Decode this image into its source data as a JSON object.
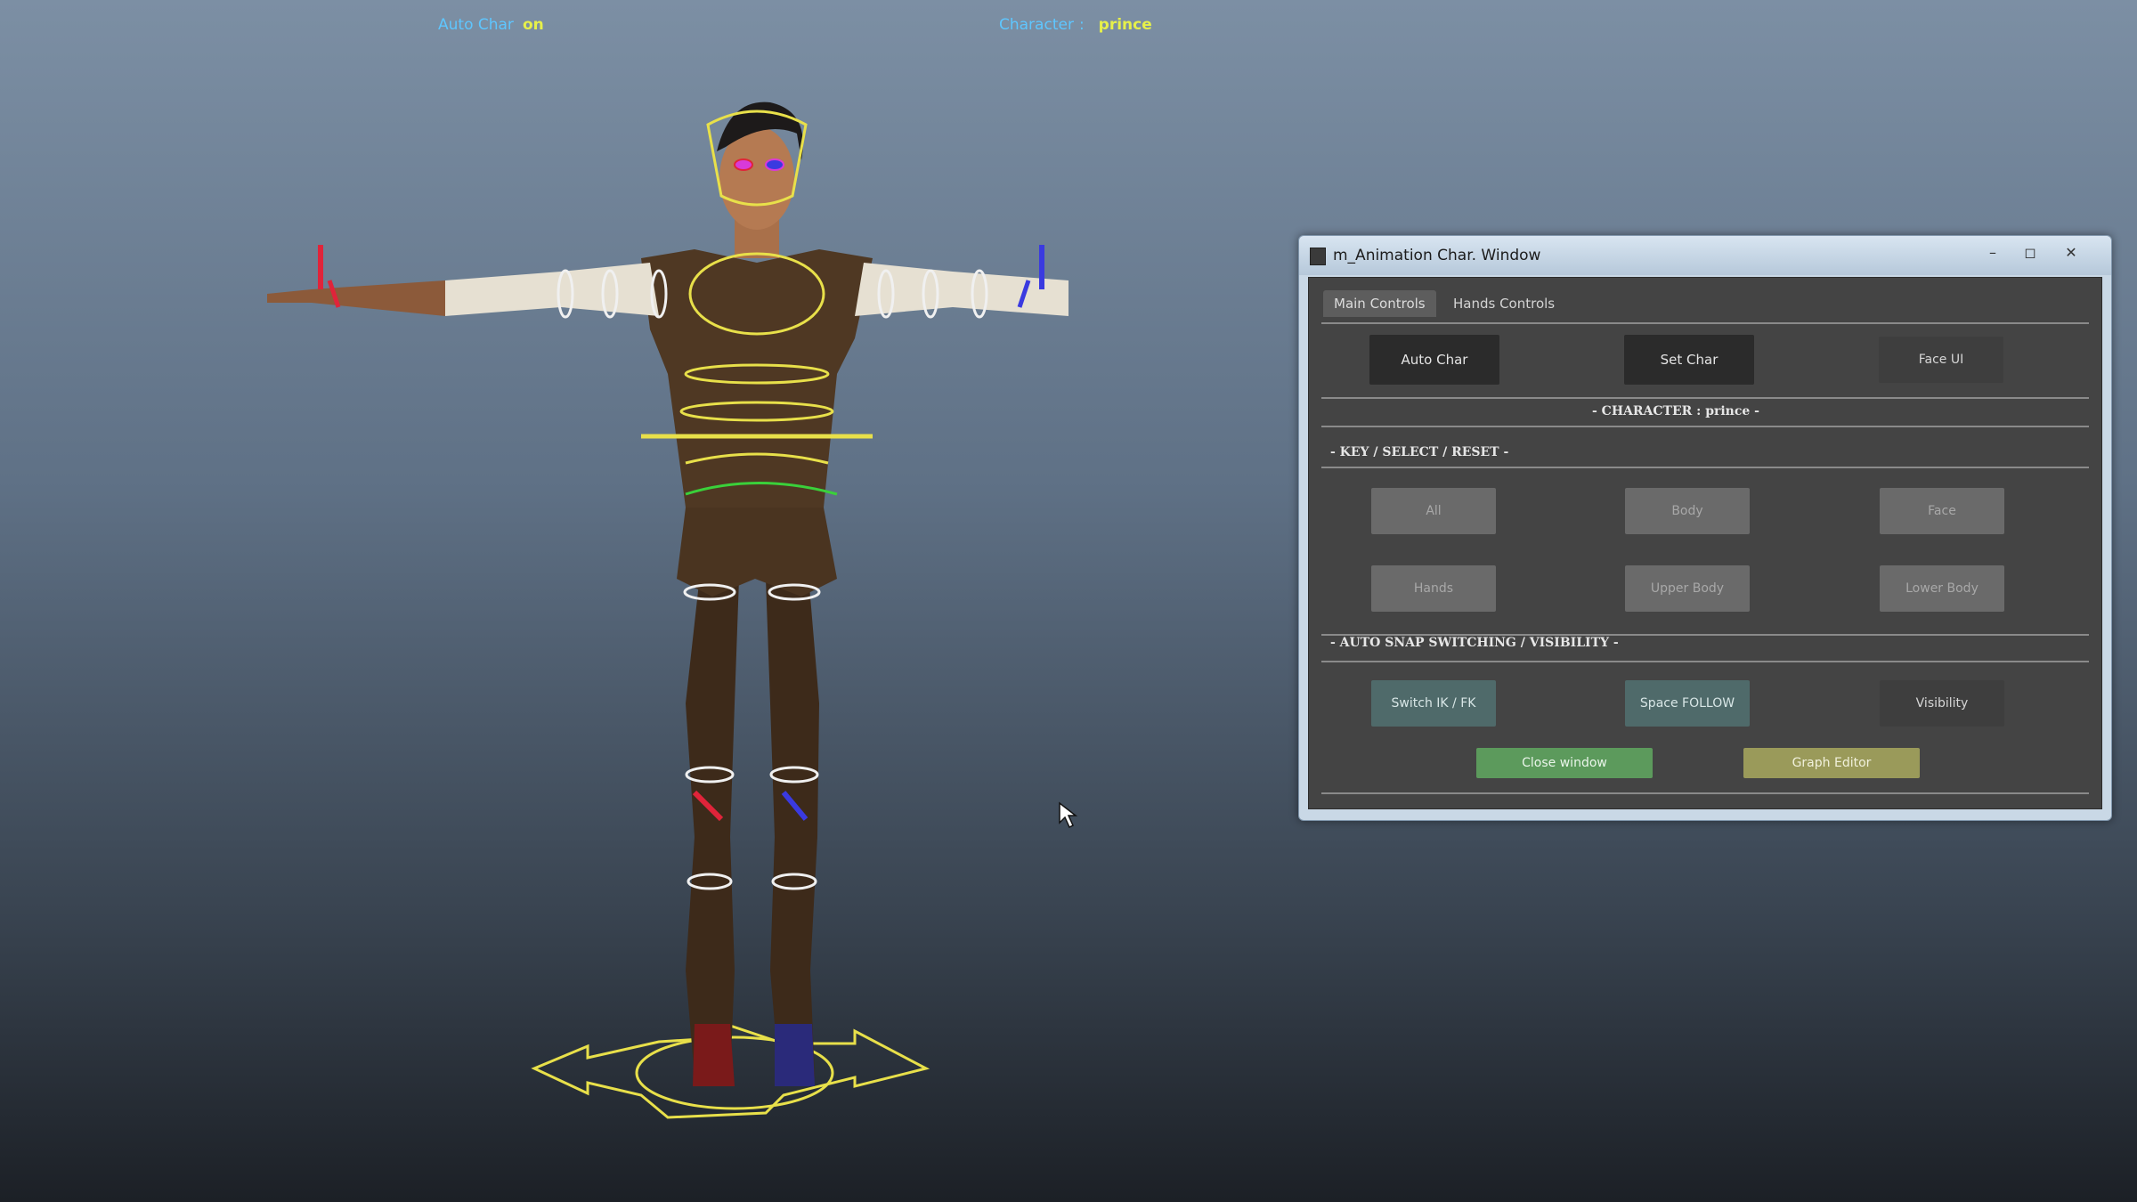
{
  "hud": {
    "left_label": "Auto Char",
    "left_value": "on",
    "right_label": "Character",
    "right_value": "prince"
  },
  "window": {
    "title": "m_Animation Char. Window",
    "minimize": "–",
    "maximize": "◻",
    "close": "✕",
    "tabs": [
      {
        "label": "Main Controls",
        "active": true
      },
      {
        "label": "Hands Controls",
        "active": false
      }
    ],
    "top_buttons": {
      "auto_char": "Auto Char",
      "set_char": "Set Char",
      "face_ui": "Face UI"
    },
    "character_label": "- CHARACTER : prince -",
    "key_select_reset_label": "- KEY / SELECT / RESET -",
    "select_buttons": {
      "all": "All",
      "body": "Body",
      "face": "Face",
      "hands": "Hands",
      "upper_body": "Upper Body",
      "lower_body": "Lower Body"
    },
    "auto_snap_label": "- AUTO SNAP SWITCHING / VISIBILITY -",
    "snap_buttons": {
      "switch_ik_fk": "Switch IK / FK",
      "space_follow": "Space FOLLOW",
      "visibility": "Visibility"
    },
    "bottom_buttons": {
      "close_window": "Close window",
      "graph_editor": "Graph Editor"
    }
  },
  "colors": {
    "hud_label": "#5ec6ff",
    "hud_value": "#e6f04a",
    "rig_yellow": "#e8e04a",
    "rig_red": "#e0243a",
    "rig_blue": "#3a3ae0",
    "rig_green": "#3ad03a",
    "panel_bg": "#444444"
  }
}
